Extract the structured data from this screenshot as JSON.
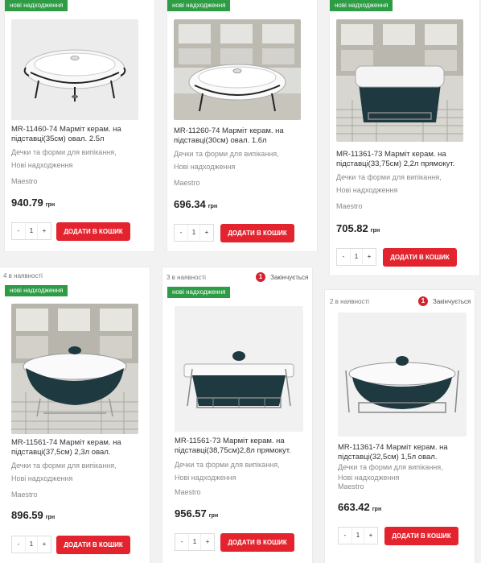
{
  "products": [
    {
      "badge": "нові надходження",
      "availability": "",
      "ending": "",
      "title": "MR-11460-74 Марміт керам. на підставці(35см) овал. 2.5л",
      "category1": "Дечки та форми для випікання,",
      "category2": "Нові надходження",
      "brand": "Maestro",
      "price": "940.79",
      "currency": "грн",
      "qty": "1",
      "minus": "-",
      "plus": "+",
      "cart_label": "ДОДАТИ В КОШИК"
    },
    {
      "badge": "нові надходження",
      "availability": "",
      "ending": "",
      "title": "MR-11260-74 Марміт керам. на підставці(30см) овал. 1.6л",
      "category1": "Дечки та форми для випікання,",
      "category2": "Нові надходження",
      "brand": "Maestro",
      "price": "696.34",
      "currency": "грн",
      "qty": "1",
      "minus": "-",
      "plus": "+",
      "cart_label": "ДОДАТИ В КОШИК"
    },
    {
      "badge": "нові надходження",
      "availability": "",
      "ending": "",
      "title": "MR-11361-73 Марміт керам. на підставці(33,75см) 2,2л прямокут.",
      "category1": "Дечки та форми для випікання,",
      "category2": "Нові надходження",
      "brand": "Maestro",
      "price": "705.82",
      "currency": "грн",
      "qty": "1",
      "minus": "-",
      "plus": "+",
      "cart_label": "ДОДАТИ В КОШИК"
    },
    {
      "badge": "нові надходження",
      "availability": "4 в наявності",
      "ending": "",
      "title": "MR-11561-74 Марміт керам. на підставці(37,5см) 2,3л овал.",
      "category1": "Дечки та форми для випікання,",
      "category2": "Нові надходження",
      "brand": "Maestro",
      "price": "896.59",
      "currency": "грн",
      "qty": "1",
      "minus": "-",
      "plus": "+",
      "cart_label": "ДОДАТИ В КОШИК"
    },
    {
      "badge": "нові надходження",
      "availability": "3 в наявності",
      "ending": "Закінчується",
      "ending_count": "1",
      "title": "MR-11561-73 Марміт керам. на підставці(38,75см)2,8л прямокут.",
      "category1": "Дечки та форми для випікання,",
      "category2": "Нові надходження",
      "brand": "Maestro",
      "price": "956.57",
      "currency": "грн",
      "qty": "1",
      "minus": "-",
      "plus": "+",
      "cart_label": "ДОДАТИ В КОШИК"
    },
    {
      "badge": "",
      "availability": "2 в наявності",
      "ending": "Закінчується",
      "ending_count": "1",
      "title": "MR-11361-74 Марміт керам. на підставці(32,5см) 1,5л овал.",
      "category1": "Дечки та форми для випікання,",
      "category2": "Нові надходження",
      "brand": "Maestro",
      "price": "663.42",
      "currency": "грн",
      "qty": "1",
      "minus": "-",
      "plus": "+",
      "cart_label": "ДОДАТИ В КОШИК"
    }
  ],
  "colors": {
    "badge_green": "#2e9b45",
    "cart_red": "#e3232e",
    "dish_dark": "#1e3a40"
  }
}
